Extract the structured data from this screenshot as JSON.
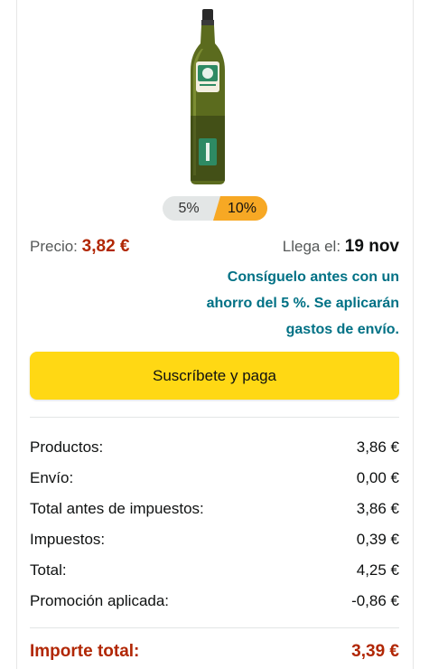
{
  "discount_options": [
    "5%",
    "10%"
  ],
  "price": {
    "label": "Precio:",
    "value": "3,82 €"
  },
  "delivery": {
    "label": "Llega el:",
    "date": "19 nov"
  },
  "promo": {
    "line1": "Consíguelo antes con un",
    "line2": "ahorro del 5 %. Se aplicarán",
    "line3": "gastos de envío."
  },
  "subscribe_button": "Suscríbete y paga",
  "summary": [
    {
      "label": "Productos:",
      "value": "3,86 €"
    },
    {
      "label": "Envío:",
      "value": "0,00 €"
    },
    {
      "label": "Total antes de impuestos:",
      "value": "3,86 €"
    },
    {
      "label": "Impuestos:",
      "value": "0,39 €"
    },
    {
      "label": "Total:",
      "value": "4,25 €"
    },
    {
      "label": "Promoción aplicada:",
      "value": "-0,86 €"
    }
  ],
  "total": {
    "label": "Importe total:",
    "value": "3,39 €"
  },
  "colors": {
    "accent_button": "#ffd814",
    "price": "#b12704",
    "link": "#007185",
    "selected_chip": "#f7a824"
  }
}
